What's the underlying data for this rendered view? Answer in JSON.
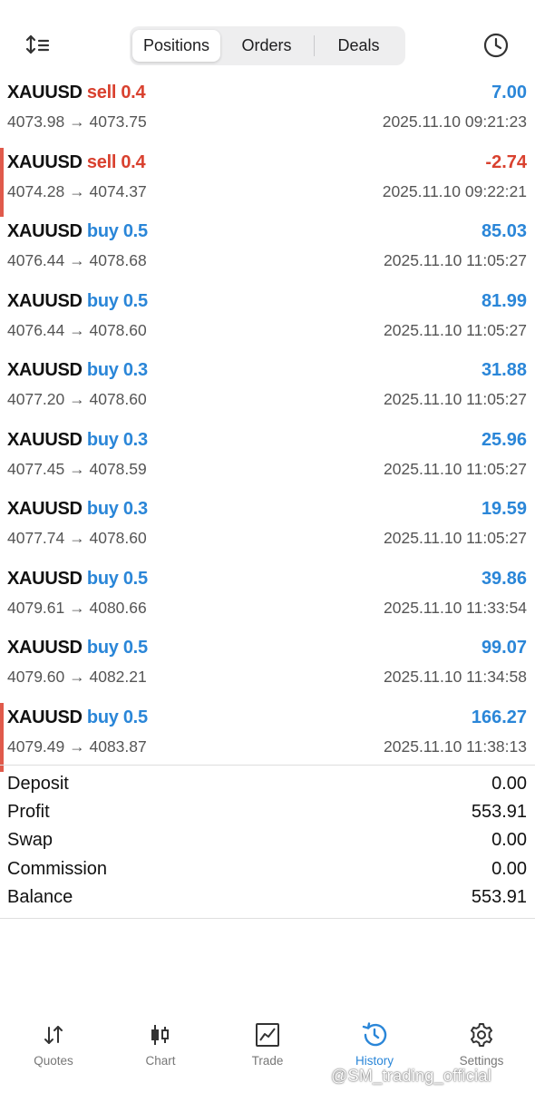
{
  "header": {
    "tabs": [
      {
        "label": "Positions",
        "active": true
      },
      {
        "label": "Orders",
        "active": false
      },
      {
        "label": "Deals",
        "active": false
      }
    ],
    "sort_icon": "sort-icon",
    "history_period_icon": "clock-icon"
  },
  "deals": [
    {
      "symbol": "XAUUSD",
      "side": "sell",
      "volume": "0.4",
      "prices": "4073.98 → 4073.75",
      "profit": "7.00",
      "time": "2025.11.10 09:21:23",
      "marked": false
    },
    {
      "symbol": "XAUUSD",
      "side": "sell",
      "volume": "0.4",
      "prices": "4074.28 → 4074.37",
      "profit": "-2.74",
      "time": "2025.11.10 09:22:21",
      "marked": true
    },
    {
      "symbol": "XAUUSD",
      "side": "buy",
      "volume": "0.5",
      "prices": "4076.44 → 4078.68",
      "profit": "85.03",
      "time": "2025.11.10 11:05:27",
      "marked": false
    },
    {
      "symbol": "XAUUSD",
      "side": "buy",
      "volume": "0.5",
      "prices": "4076.44 → 4078.60",
      "profit": "81.99",
      "time": "2025.11.10 11:05:27",
      "marked": false
    },
    {
      "symbol": "XAUUSD",
      "side": "buy",
      "volume": "0.3",
      "prices": "4077.20 → 4078.60",
      "profit": "31.88",
      "time": "2025.11.10 11:05:27",
      "marked": false
    },
    {
      "symbol": "XAUUSD",
      "side": "buy",
      "volume": "0.3",
      "prices": "4077.45 → 4078.59",
      "profit": "25.96",
      "time": "2025.11.10 11:05:27",
      "marked": false
    },
    {
      "symbol": "XAUUSD",
      "side": "buy",
      "volume": "0.3",
      "prices": "4077.74 → 4078.60",
      "profit": "19.59",
      "time": "2025.11.10 11:05:27",
      "marked": false
    },
    {
      "symbol": "XAUUSD",
      "side": "buy",
      "volume": "0.5",
      "prices": "4079.61 → 4080.66",
      "profit": "39.86",
      "time": "2025.11.10 11:33:54",
      "marked": false
    },
    {
      "symbol": "XAUUSD",
      "side": "buy",
      "volume": "0.5",
      "prices": "4079.60 → 4082.21",
      "profit": "99.07",
      "time": "2025.11.10 11:34:58",
      "marked": false
    },
    {
      "symbol": "XAUUSD",
      "side": "buy",
      "volume": "0.5",
      "prices": "4079.49 → 4083.87",
      "profit": "166.27",
      "time": "2025.11.10 11:38:13",
      "marked": true
    }
  ],
  "summary": [
    {
      "label": "Deposit",
      "value": "0.00"
    },
    {
      "label": "Profit",
      "value": "553.91"
    },
    {
      "label": "Swap",
      "value": "0.00"
    },
    {
      "label": "Commission",
      "value": "0.00"
    },
    {
      "label": "Balance",
      "value": "553.91"
    }
  ],
  "nav": [
    {
      "label": "Quotes",
      "icon": "quotes-icon",
      "active": false
    },
    {
      "label": "Chart",
      "icon": "chart-icon",
      "active": false
    },
    {
      "label": "Trade",
      "icon": "trade-icon",
      "active": false
    },
    {
      "label": "History",
      "icon": "history-icon",
      "active": true
    },
    {
      "label": "Settings",
      "icon": "settings-icon",
      "active": false
    }
  ],
  "watermark": "@SM_trading_official",
  "colors": {
    "buy": "#2a86d8",
    "sell": "#d9412f",
    "marker": "#e05a4b",
    "active_nav": "#2a86d8"
  }
}
